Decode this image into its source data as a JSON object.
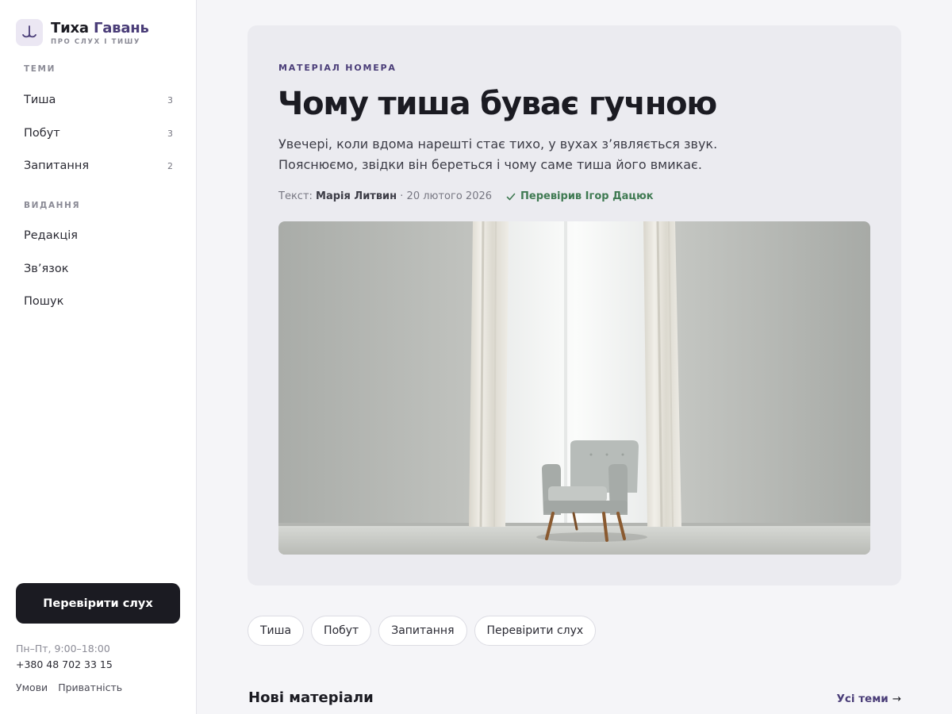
{
  "brand": {
    "name_part1": "Тиха",
    "name_part2": "Гавань",
    "tagline": "ПРО СЛУХ І ТИШУ",
    "logo_icon": "tuning-fork-icon",
    "accent_color": "#4a3d78"
  },
  "sidebar": {
    "topics_heading": "ТЕМИ",
    "topics": [
      {
        "label": "Тиша",
        "count": "3"
      },
      {
        "label": "Побут",
        "count": "3"
      },
      {
        "label": "Запитання",
        "count": "2"
      }
    ],
    "edition_heading": "ВИДАННЯ",
    "edition": [
      {
        "label": "Редакція"
      },
      {
        "label": "Зв’язок"
      },
      {
        "label": "Пошук"
      }
    ],
    "cta_label": "Перевірити слух",
    "hours": "Пн–Пт, 9:00–18:00",
    "phone": "+380 48 702 33 15",
    "legal": [
      "Умови",
      "Приватність"
    ]
  },
  "feature": {
    "eyebrow": "МАТЕРІАЛ НОМЕРА",
    "title": "Чому тиша буває гучною",
    "lead": "Увечері, коли вдома нарешті стає тихо, у вухах з’являється звук. Пояснюємо, звідки він береться і чому саме тиша його вмикає.",
    "byline_prefix": "Текст:",
    "author": "Марія Литвин",
    "date": "· 20 лютого 2026",
    "verified_label": "Перевірив Ігор Дацюк",
    "verified_color": "#3f7a52",
    "image_subject": "armchair-by-window-photo"
  },
  "tags": [
    "Тиша",
    "Побут",
    "Запитання",
    "Перевірити слух"
  ],
  "section": {
    "title": "Нові матеріали",
    "all_label": "Усі теми",
    "all_arrow": "→"
  }
}
